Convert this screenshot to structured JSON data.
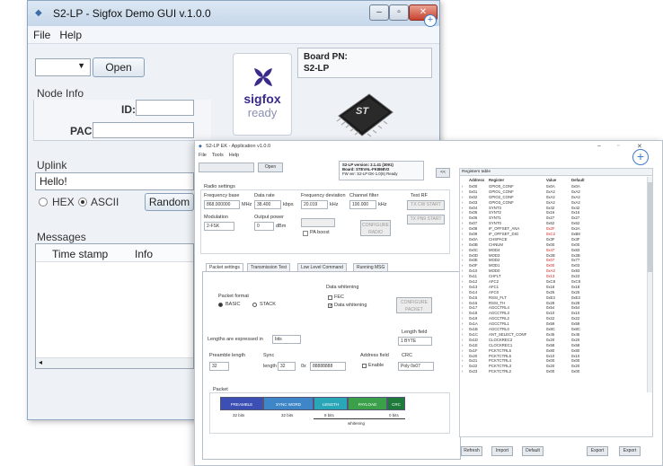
{
  "back_window": {
    "title": "S2-LP - Sigfox Demo GUI v.1.0.0",
    "menu": [
      "File",
      "Help"
    ],
    "controls": {
      "minimize": "–",
      "maximize": "▫",
      "close": "✕"
    },
    "open_button": "Open",
    "board_pn_label": "Board PN:",
    "board_pn_value": "S2-LP",
    "sigfox_logo_text_1": "sigfox",
    "sigfox_logo_text_2": "ready",
    "chip_label": "ST",
    "node_info": {
      "header": "Node Info",
      "id_label": "ID:",
      "id_value": "",
      "pac_label": "PAC:",
      "pac_value": ""
    },
    "uplink": {
      "header": "Uplink",
      "message": "Hello!",
      "hex_label": "HEX",
      "ascii_label": "ASCII",
      "selected": "ASCII",
      "random_button": "Random"
    },
    "messages": {
      "header": "Messages",
      "columns": [
        "Time stamp",
        "Info"
      ]
    }
  },
  "front_window": {
    "title": "S2-LP EK - Application v1.0.0",
    "menu": [
      "File",
      "Tools",
      "Help"
    ],
    "controls": {
      "minimize": "–",
      "maximize": "▫",
      "close": "✕"
    },
    "port_select": "",
    "open_button": "Open",
    "device_info": [
      "S2-LP version: 2.1.41 (3091)",
      "Board: STEVAL-FKI868V2",
      "FW ver: S2-LP DK-1.0(6) Ready"
    ],
    "small_button": "<<",
    "radio_settings": "Radio settings",
    "freq_base_label": "Frequency base",
    "freq_base_value": "868.000000",
    "freq_base_unit": "MHz",
    "data_rate_label": "Data rate",
    "data_rate_value": "38.400",
    "data_rate_unit": "kbps",
    "freq_dev_label": "Frequency deviation",
    "freq_dev_value": "20.019",
    "freq_dev_unit": "kHz",
    "ch_filter_label": "Channel filter",
    "ch_filter_value": "100.000",
    "ch_filter_unit": "kHz",
    "test_rf_label": "Test RF",
    "tx_cw_button": "TX CW START",
    "tx_pn9_button": "TX PN9 START",
    "modulation_label": "Modulation",
    "modulation_value": "2-FSK",
    "output_power_label": "Output power",
    "output_power_value": "0",
    "output_power_unit": "dBm",
    "pa_mode_value": "",
    "pa_boost_label": "PA boost",
    "configure_radio_button": "CONFIGURE RADIO",
    "tabs": [
      "Packet settings",
      "Transmission Test",
      "Low Level Command",
      "Running MSG"
    ],
    "active_tab": "Packet settings",
    "packet_format_label": "Packet format",
    "basic_label": "BASIC",
    "stack_label": "STACK",
    "packet_format_selected": "BASIC",
    "data_whitening_label": "Data whitening",
    "fec_label": "FEC",
    "data_whitening_check_label": "Data whitening",
    "configure_packet_button": "CONFIGURE PACKET",
    "lengths_label": "Lengths are expressed in",
    "lengths_unit": "bits",
    "length_field_label": "Length field",
    "length_field_value": "1 BYTE",
    "preamble_length_label": "Preamble length",
    "preamble_length_value": "32",
    "sync_label": "Sync",
    "sync_length_label": "length",
    "sync_length_value": "32",
    "sync_word_label": "0x",
    "sync_word_value": "88888888",
    "address_field_label": "Address field",
    "enable_label": "Enable",
    "crc_label": "CRC",
    "crc_value": "Poly 0x07",
    "packet_label": "Packet",
    "packet_fields": [
      {
        "name": "PREAMBLE",
        "bits": "32 bits",
        "color": "#3b4fb5"
      },
      {
        "name": "SYNC WORD",
        "bits": "32 bits",
        "color": "#3f86c8"
      },
      {
        "name": "LENGTH",
        "bits": "8 bits",
        "color": "#29a6b8"
      },
      {
        "name": "PAYLOAD",
        "bits": "",
        "color": "#3aa04a"
      },
      {
        "name": "CRC",
        "bits": "0 bits",
        "color": "#1d7a3b"
      }
    ],
    "whitening_label": "whitening",
    "registers": {
      "title": "Registers table",
      "columns": [
        "Address",
        "Register",
        "Value",
        "Default"
      ],
      "rows": [
        [
          "0x00",
          "GPIO0_CONF",
          "0x0A",
          "0x0A"
        ],
        [
          "0x01",
          "GPIO1_CONF",
          "0xA2",
          "0xA2"
        ],
        [
          "0x02",
          "GPIO2_CONF",
          "0xA2",
          "0xA2"
        ],
        [
          "0x03",
          "GPIO3_CONF",
          "0xA2",
          "0xA2"
        ],
        [
          "0x04",
          "SYNT3",
          "0x42",
          "0x42"
        ],
        [
          "0x05",
          "SYNT2",
          "0x16",
          "0x16"
        ],
        [
          "0x06",
          "SYNT1",
          "0x27",
          "0x27"
        ],
        [
          "0x07",
          "SYNT0",
          "0x62",
          "0x62"
        ],
        [
          "0x08",
          "IF_OFFSET_ANA",
          "0x2F",
          "0x2A"
        ],
        [
          "0x09",
          "IF_OFFSET_DIG",
          "0xC2",
          "0xB8"
        ],
        [
          "0x0A",
          "CHSPACE",
          "0x3F",
          "0x3F"
        ],
        [
          "0x0B",
          "CHNUM",
          "0x00",
          "0x00"
        ],
        [
          "0x0C",
          "MOD4",
          "0x47",
          "0x83"
        ],
        [
          "0x0D",
          "MOD3",
          "0x2B",
          "0x2B"
        ],
        [
          "0x0E",
          "MOD2",
          "0x07",
          "0x77"
        ],
        [
          "0x0F",
          "MOD1",
          "0x00",
          "0x03"
        ],
        [
          "0x10",
          "MOD0",
          "0xA3",
          "0x93"
        ],
        [
          "0x11",
          "CHFLT",
          "0x13",
          "0x23"
        ],
        [
          "0x12",
          "AFC2",
          "0xC8",
          "0xC8"
        ],
        [
          "0x13",
          "AFC1",
          "0x18",
          "0x18"
        ],
        [
          "0x14",
          "AFC0",
          "0x25",
          "0x25"
        ],
        [
          "0x15",
          "RSSI_FLT",
          "0xE3",
          "0xE3"
        ],
        [
          "0x16",
          "RSSI_TH",
          "0x28",
          "0x28"
        ],
        [
          "0x17",
          "AGCCTRL4",
          "0x54",
          "0x54"
        ],
        [
          "0x18",
          "AGCCTRL3",
          "0x10",
          "0x10"
        ],
        [
          "0x19",
          "AGCCTRL2",
          "0x22",
          "0x22"
        ],
        [
          "0x1A",
          "AGCCTRL1",
          "0x59",
          "0x59"
        ],
        [
          "0x1B",
          "AGCCTRL0",
          "0x8C",
          "0x8C"
        ],
        [
          "0x1C",
          "ANT_SELECT_CONF",
          "0x45",
          "0x45"
        ],
        [
          "0x1D",
          "CLOCKREC2",
          "0x20",
          "0x20"
        ],
        [
          "0x1E",
          "CLOCKREC1",
          "0x58",
          "0x58"
        ],
        [
          "0x1F",
          "PCKTCTRL6",
          "0x80",
          "0x80"
        ],
        [
          "0x20",
          "PCKTCTRL5",
          "0x10",
          "0x10"
        ],
        [
          "0x21",
          "PCKTCTRL4",
          "0x00",
          "0x00"
        ],
        [
          "0x22",
          "PCKTCTRL3",
          "0x20",
          "0x20"
        ],
        [
          "0x23",
          "PCKTCTRL2",
          "0x00",
          "0x00"
        ]
      ],
      "buttons": [
        "Refresh",
        "Import",
        "Default",
        "Export",
        "Export"
      ]
    }
  }
}
